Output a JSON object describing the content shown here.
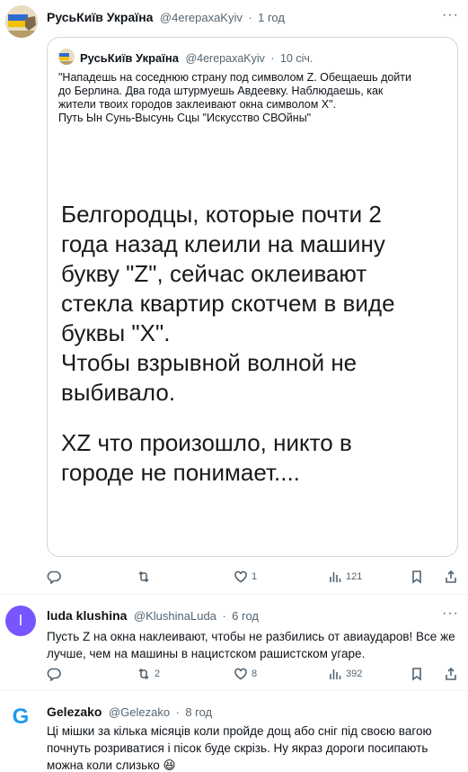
{
  "tweet1": {
    "name": "РусьКиїв Україна",
    "handle": "@4erepaxaKyiv",
    "dot": "·",
    "time": "1 год",
    "more": "···",
    "quote": {
      "name": "РусьКиїв Україна",
      "handle": "@4erepaxaKyiv",
      "dot": "·",
      "time": "10 січ.",
      "text_lines": [
        "\"Нападешь на соседнюю страну под символом Z. Обещаешь дойти",
        "до Берлина. Два года штурмуешь Авдеевку. Наблюдаешь, как",
        "жители твоих городов заклеивают окна символом Х\".",
        "Путь Ын Сунь-Высунь Сцы \"Искусство СВОйны\""
      ],
      "image_text_1": "Белгородцы, которые почти 2\nгода назад клеили на машину\nбукву \"Z\", сейчас оклеивают\nстекла квартир скотчем в виде\nбуквы \"Х\".\nЧтобы взрывной волной не\nвыбивало.",
      "image_text_2": "XZ что произошло, никто в\nгороде не понимает...."
    },
    "actions": {
      "replies": "",
      "retweets": "",
      "likes": "1",
      "views": "121"
    }
  },
  "tweet2": {
    "avatar_letter": "l",
    "avatar_color": "#7856ff",
    "name": "luda klushina",
    "handle": "@KlushinaLuda",
    "dot": "·",
    "time": "6 год",
    "text_lines": [
      "Пусть Z на окна наклеивают, чтобы не разбились от авиаударов! Все же",
      "лучше, чем на машины в нацистском рашистском угаре."
    ],
    "actions": {
      "replies": "",
      "retweets": "2",
      "likes": "8",
      "views": "392"
    }
  },
  "tweet3": {
    "avatar_letter": "G",
    "avatar_color": "#1d9bf0",
    "name": "Gelezako",
    "handle": "@Gelezako",
    "dot": "·",
    "time": "8 год",
    "text_lines": [
      "Ці мішки за кілька місяців коли пройде дощ або сніг під своєю вагою",
      "почнуть розриватися і пісок буде скрізь. Ну якраз дороги посипають",
      "можна коли слизько 😆"
    ]
  }
}
